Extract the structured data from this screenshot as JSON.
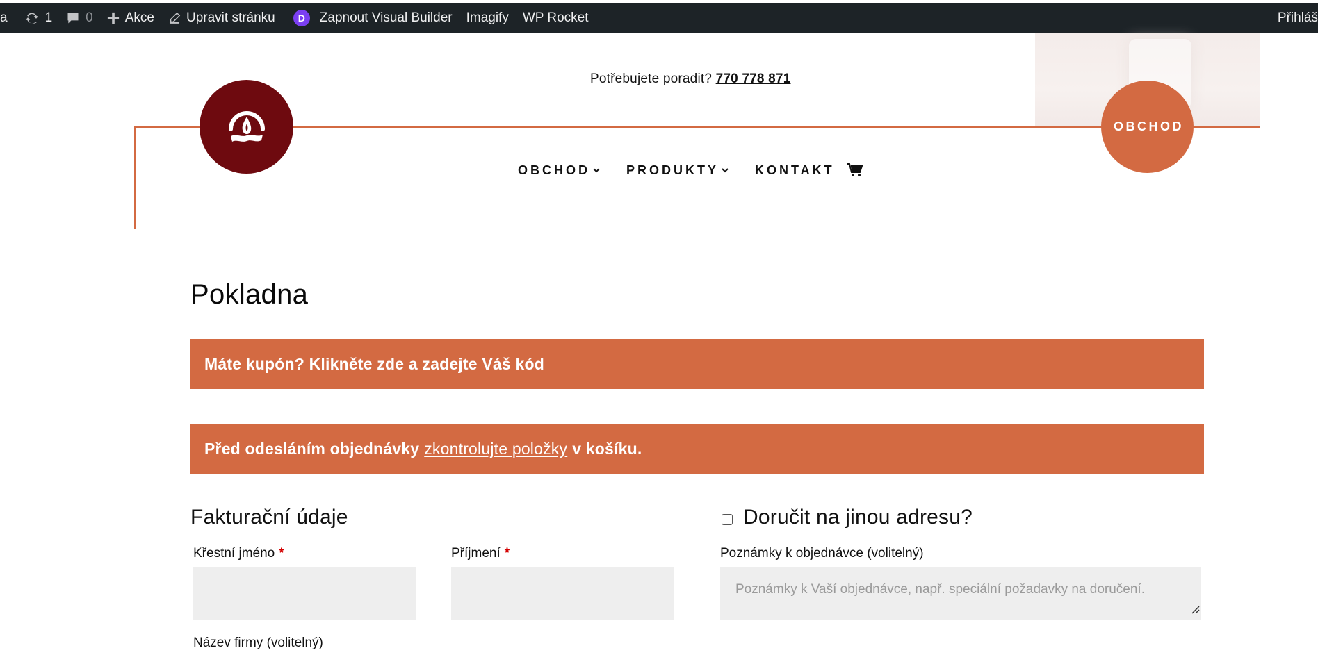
{
  "adminbar": {
    "site_fragment": "a",
    "updates_count": "1",
    "comments_count": "0",
    "new_label": "Akce",
    "edit_label": "Upravit stránku",
    "divi_letter": "D",
    "visual_builder_label": "Zapnout Visual Builder",
    "imagify_label": "Imagify",
    "wprocket_label": "WP Rocket",
    "account_label": "Přihláš"
  },
  "header": {
    "phone_prompt": "Potřebujete poradit?",
    "phone_number": "770 778 871",
    "shop_circle_label": "OBCHOD",
    "nav": [
      {
        "label": "OBCHOD"
      },
      {
        "label": "PRODUKTY"
      },
      {
        "label": "KONTAKT"
      }
    ]
  },
  "page": {
    "title": "Pokladna"
  },
  "notices": {
    "coupon": "Máte kupón? Klikněte zde a zadejte Váš kód",
    "review_prefix": "Před odesláním objednávky",
    "review_link": "zkontrolujte položky",
    "review_suffix": "v košíku."
  },
  "billing": {
    "heading": "Fakturační údaje",
    "first_name_label": "Křestní jméno",
    "last_name_label": "Příjmení",
    "required_mark": "*",
    "company_label": "Název firmy (volitelný)"
  },
  "shipping": {
    "heading": "Doručit na jinou adresu?",
    "notes_label": "Poznámky k objednávce (volitelný)",
    "notes_placeholder": "Poznámky k Vaší objednávce, např. speciální požadavky na doručení."
  },
  "colors": {
    "accent": "#d36a42",
    "logo_bg": "#6e0a0f",
    "adminbar_bg": "#1d2327",
    "input_bg": "#eeeeee"
  }
}
